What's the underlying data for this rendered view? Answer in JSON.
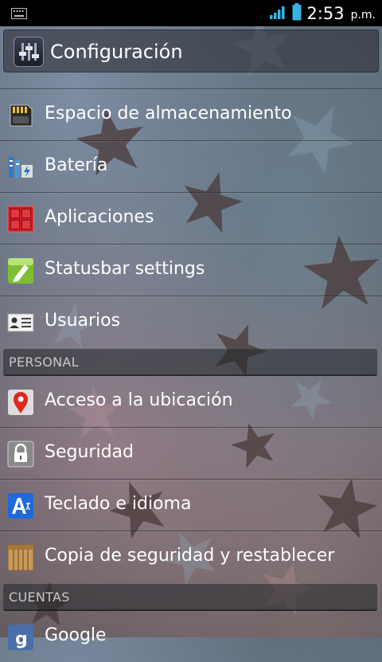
{
  "status_bar": {
    "time": "2:53",
    "ampm": "p.m.",
    "icons": [
      "keyboard-notification-icon",
      "signal-icon",
      "battery-icon"
    ]
  },
  "action_bar": {
    "title": "Configuración",
    "icon": "settings-app-icon"
  },
  "device_items": [
    {
      "label": "Espacio de almacenamiento",
      "icon": "sd-card-icon"
    },
    {
      "label": "Batería",
      "icon": "battery-settings-icon"
    },
    {
      "label": "Aplicaciones",
      "icon": "apps-icon"
    },
    {
      "label": "Statusbar settings",
      "icon": "statusbar-settings-icon"
    },
    {
      "label": "Usuarios",
      "icon": "users-icon"
    }
  ],
  "personal": {
    "header": "PERSONAL",
    "items": [
      {
        "label": "Acceso a la ubicación",
        "icon": "location-pin-icon"
      },
      {
        "label": "Seguridad",
        "icon": "lock-icon"
      },
      {
        "label": "Teclado e idioma",
        "icon": "keyboard-language-icon"
      },
      {
        "label": "Copia de seguridad y restablecer",
        "icon": "backup-box-icon"
      }
    ]
  },
  "accounts": {
    "header": "CUENTAS",
    "items": [
      {
        "label": "Google",
        "icon": "google-icon"
      }
    ]
  }
}
